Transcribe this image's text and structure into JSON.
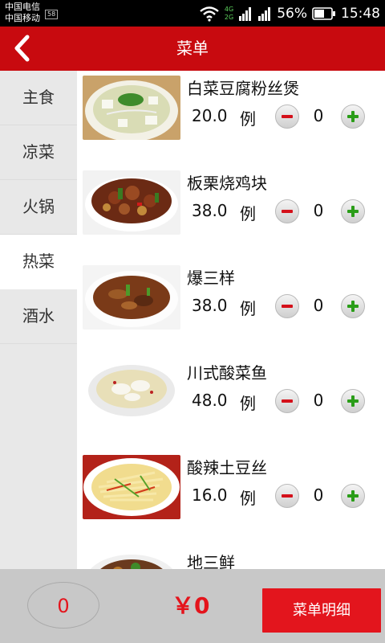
{
  "status_bar": {
    "carrier1": "中国电信",
    "carrier2": "中国移动",
    "network_badge": "58",
    "net_4g": "4G",
    "net_2g": "2G",
    "battery_percent": "56%",
    "time": "15:48"
  },
  "header": {
    "title": "菜单"
  },
  "sidebar": {
    "categories": [
      {
        "label": "主食",
        "active": false
      },
      {
        "label": "凉菜",
        "active": false
      },
      {
        "label": "火锅",
        "active": false
      },
      {
        "label": "热菜",
        "active": true
      },
      {
        "label": "酒水",
        "active": false
      }
    ]
  },
  "dishes": [
    {
      "name": "白菜豆腐粉丝煲",
      "price": "20.0",
      "unit": "例",
      "qty": "0"
    },
    {
      "name": "板栗烧鸡块",
      "price": "38.0",
      "unit": "例",
      "qty": "0"
    },
    {
      "name": "爆三样",
      "price": "38.0",
      "unit": "例",
      "qty": "0"
    },
    {
      "name": "川式酸菜鱼",
      "price": "48.0",
      "unit": "例",
      "qty": "0"
    },
    {
      "name": "酸辣土豆丝",
      "price": "16.0",
      "unit": "例",
      "qty": "0"
    },
    {
      "name": "地三鲜"
    }
  ],
  "footer": {
    "count": "0",
    "total": "￥0",
    "detail_button": "菜单明细"
  },
  "colors": {
    "brand_red": "#c80a0f",
    "accent_red": "#e3151d",
    "plus_green": "#2a9d18"
  }
}
